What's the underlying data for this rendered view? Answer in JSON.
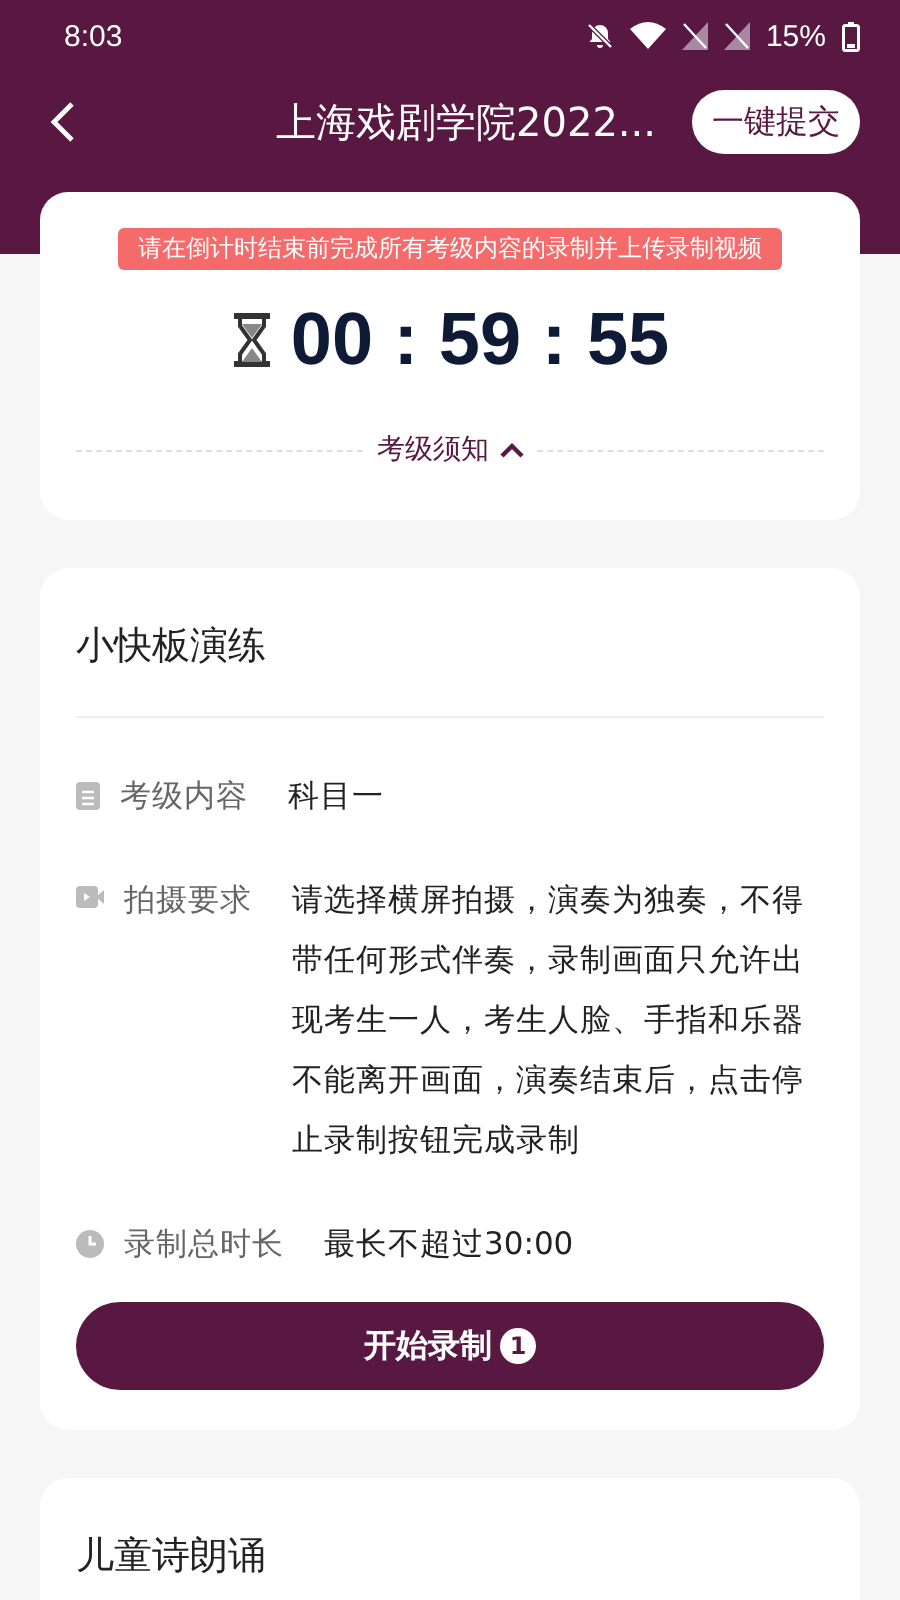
{
  "status_bar": {
    "time": "8:03",
    "battery": "15%"
  },
  "nav": {
    "title": "上海戏剧学院2022...",
    "submit": "一键提交"
  },
  "timer": {
    "tip": "请在倒计时结束前完成所有考级内容的录制并上传录制视频",
    "countdown": "00 : 59 : 55",
    "notice": "考级须知",
    "expanded": true
  },
  "tasks": [
    {
      "title": "小快板演练",
      "rows": [
        {
          "kind": "content",
          "label": "考级内容",
          "value": "科目一"
        },
        {
          "kind": "requirement",
          "label": "拍摄要求",
          "value": "请选择横屏拍摄，演奏为独奏，不得带任何形式伴奏，录制画面只允许出现考生一人，考生人脸、手指和乐器不能离开画面，演奏结束后，点击停止录制按钮完成录制"
        },
        {
          "kind": "duration",
          "label": "录制总时长",
          "value": "最长不超过30:00"
        }
      ],
      "button": "开始录制",
      "badge": "1"
    },
    {
      "title": "儿童诗朗诵"
    }
  ]
}
